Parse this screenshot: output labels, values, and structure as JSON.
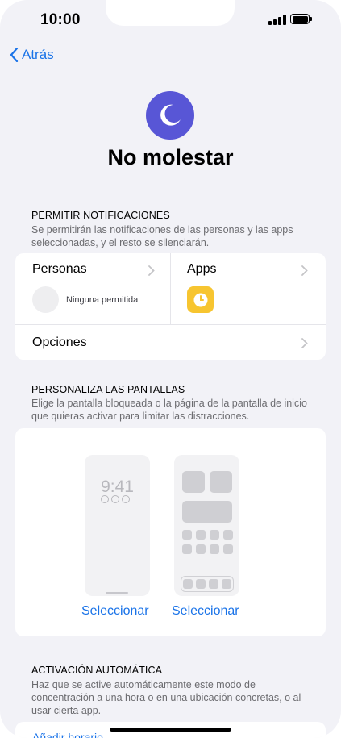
{
  "status_bar": {
    "time": "10:00"
  },
  "nav": {
    "back_label": "Atrás"
  },
  "header": {
    "title": "No molestar"
  },
  "permit": {
    "heading": "PERMITIR NOTIFICACIONES",
    "description": "Se permitirán las notificaciones de las personas y las apps seleccionadas, y el resto se silenciarán.",
    "people_label": "Personas",
    "people_note": "Ninguna permitida",
    "apps_label": "Apps",
    "options_label": "Opciones"
  },
  "screens": {
    "heading": "PERSONALIZA LAS PANTALLAS",
    "description": "Elige la pantalla bloqueada o la página de la pantalla de inicio que quieras activar para limitar las distracciones.",
    "lock_time": "9:41",
    "select_lock": "Seleccionar",
    "select_home": "Seleccionar"
  },
  "auto": {
    "heading": "ACTIVACIÓN AUTOMÁTICA",
    "description": "Haz que se active automáticamente este modo de concentración a una hora o en una ubicación concretas, o al usar cierta app.",
    "add_schedule": "Añadir horario"
  },
  "colors": {
    "accent": "#1a73e8",
    "focus": "#5856d6",
    "clock_app": "#f7c530"
  }
}
